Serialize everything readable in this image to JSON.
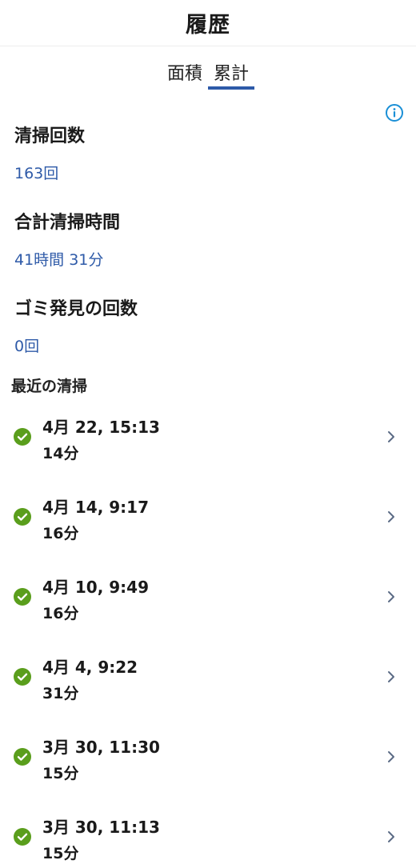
{
  "header": {
    "title": "履歴"
  },
  "tabs": [
    {
      "label": "面積",
      "active": false
    },
    {
      "label": "累計",
      "active": true
    }
  ],
  "info_icon": "info-icon",
  "stats": [
    {
      "label": "清掃回数",
      "value": "163回"
    },
    {
      "label": "合計清掃時間",
      "value": "41時間 31分"
    },
    {
      "label": "ゴミ発見の回数",
      "value": "0回"
    }
  ],
  "recent": {
    "title": "最近の清掃",
    "items": [
      {
        "datetime": "4月 22, 15:13",
        "duration": "14分",
        "status": "completed"
      },
      {
        "datetime": "4月 14, 9:17",
        "duration": "16分",
        "status": "completed"
      },
      {
        "datetime": "4月 10, 9:49",
        "duration": "16分",
        "status": "completed"
      },
      {
        "datetime": "4月 4, 9:22",
        "duration": "31分",
        "status": "completed"
      },
      {
        "datetime": "3月 30, 11:30",
        "duration": "15分",
        "status": "completed"
      },
      {
        "datetime": "3月 30, 11:13",
        "duration": "15分",
        "status": "completed"
      }
    ]
  },
  "colors": {
    "accent": "#2e5aa8",
    "success": "#5a9e1c",
    "chevron": "#5b6b85"
  }
}
